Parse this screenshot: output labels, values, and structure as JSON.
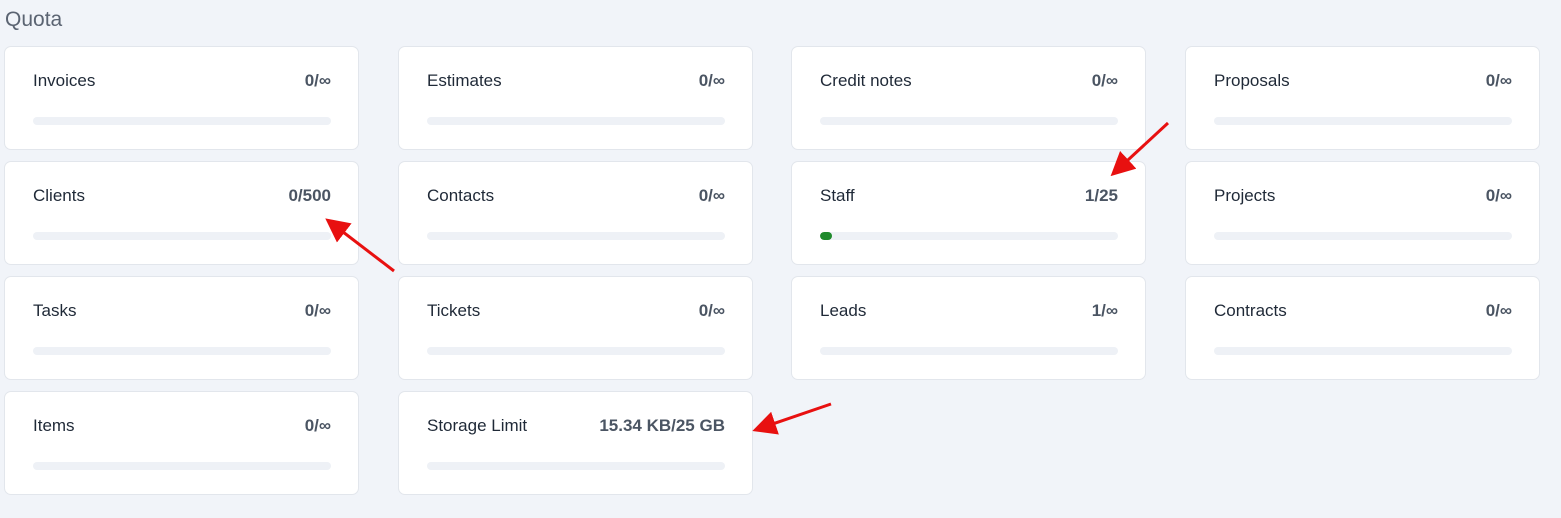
{
  "page": {
    "title": "Quota"
  },
  "quota_items": [
    {
      "label": "Invoices",
      "value": "0/∞",
      "fraction": 0
    },
    {
      "label": "Estimates",
      "value": "0/∞",
      "fraction": 0
    },
    {
      "label": "Credit notes",
      "value": "0/∞",
      "fraction": 0
    },
    {
      "label": "Proposals",
      "value": "0/∞",
      "fraction": 0
    },
    {
      "label": "Clients",
      "value": "0/500",
      "fraction": 0
    },
    {
      "label": "Contacts",
      "value": "0/∞",
      "fraction": 0
    },
    {
      "label": "Staff",
      "value": "1/25",
      "fraction": 0.04
    },
    {
      "label": "Projects",
      "value": "0/∞",
      "fraction": 0
    },
    {
      "label": "Tasks",
      "value": "0/∞",
      "fraction": 0
    },
    {
      "label": "Tickets",
      "value": "0/∞",
      "fraction": 0
    },
    {
      "label": "Leads",
      "value": "1/∞",
      "fraction": 0
    },
    {
      "label": "Contracts",
      "value": "0/∞",
      "fraction": 0
    },
    {
      "label": "Items",
      "value": "0/∞",
      "fraction": 0
    },
    {
      "label": "Storage Limit",
      "value": "15.34 KB/25 GB",
      "fraction": 0
    }
  ],
  "colors": {
    "progress_fill": "#1f8a2c",
    "progress_track": "#eef1f6",
    "annotation_arrow": "#e81010"
  },
  "annotations": {
    "arrow_icon": "red-arrow-icon"
  }
}
